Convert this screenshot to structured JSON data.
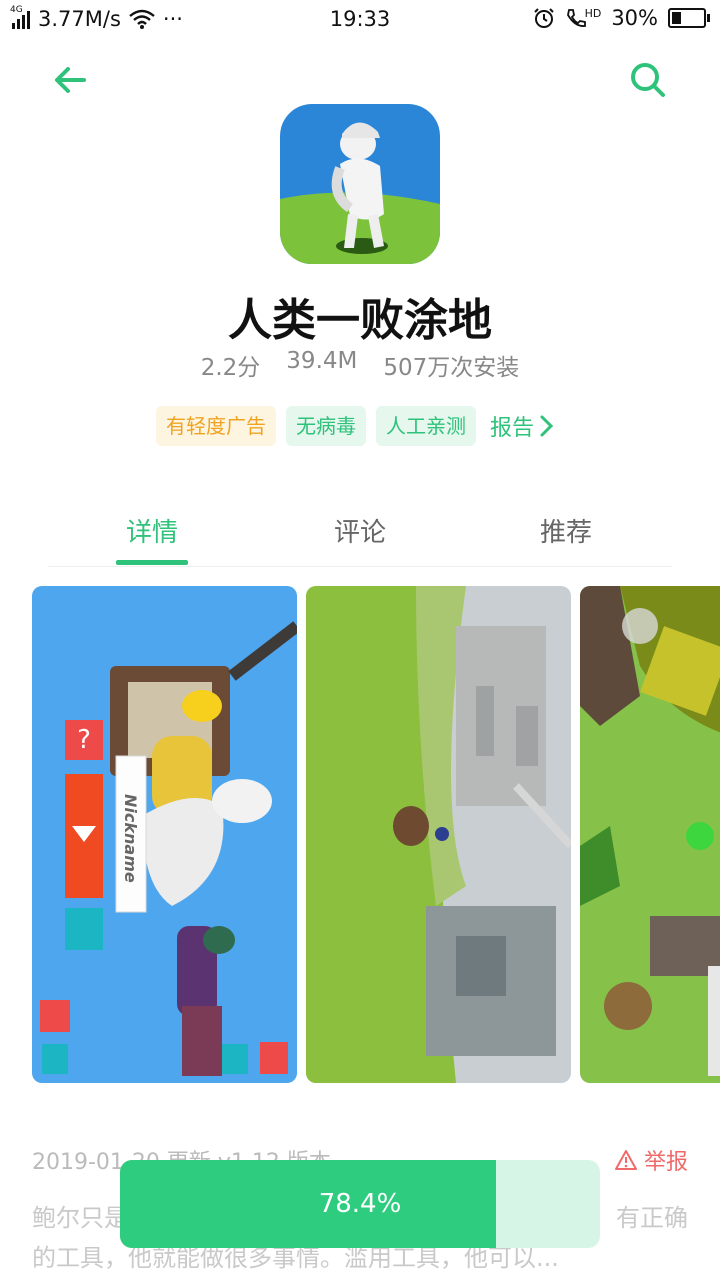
{
  "status_bar": {
    "network_label": "4G",
    "speed": "3.77M/s",
    "dots": "···",
    "time": "19:33",
    "hd_label": "HD",
    "battery": "30%",
    "battery_level": 0.3
  },
  "app": {
    "name": "人类一败涂地",
    "rating": "2.2分",
    "size": "39.4M",
    "installs": "507万次安装"
  },
  "tags": [
    "有轻度广告",
    "无病毒",
    "人工亲测"
  ],
  "report_link": "报告",
  "tabs": [
    {
      "label": "详情",
      "active": true
    },
    {
      "label": "评论",
      "active": false
    },
    {
      "label": "推荐",
      "active": false
    }
  ],
  "screenshots": {
    "nickname_label": "Nickname"
  },
  "info": {
    "update_line": "2019-01-20 更新  v1.12 版本",
    "report_label": "举报",
    "desc_line1_start": "鲍尔只是",
    "desc_line1_end": "有正确",
    "desc_line2": "的工具，他就能做很多事情。滥用工具，他可以..."
  },
  "download": {
    "progress_text": "78.4%",
    "progress": 0.784
  },
  "colors": {
    "accent": "#2ec27a",
    "ad_tag": "#f0a323",
    "report": "#f06a6a"
  }
}
